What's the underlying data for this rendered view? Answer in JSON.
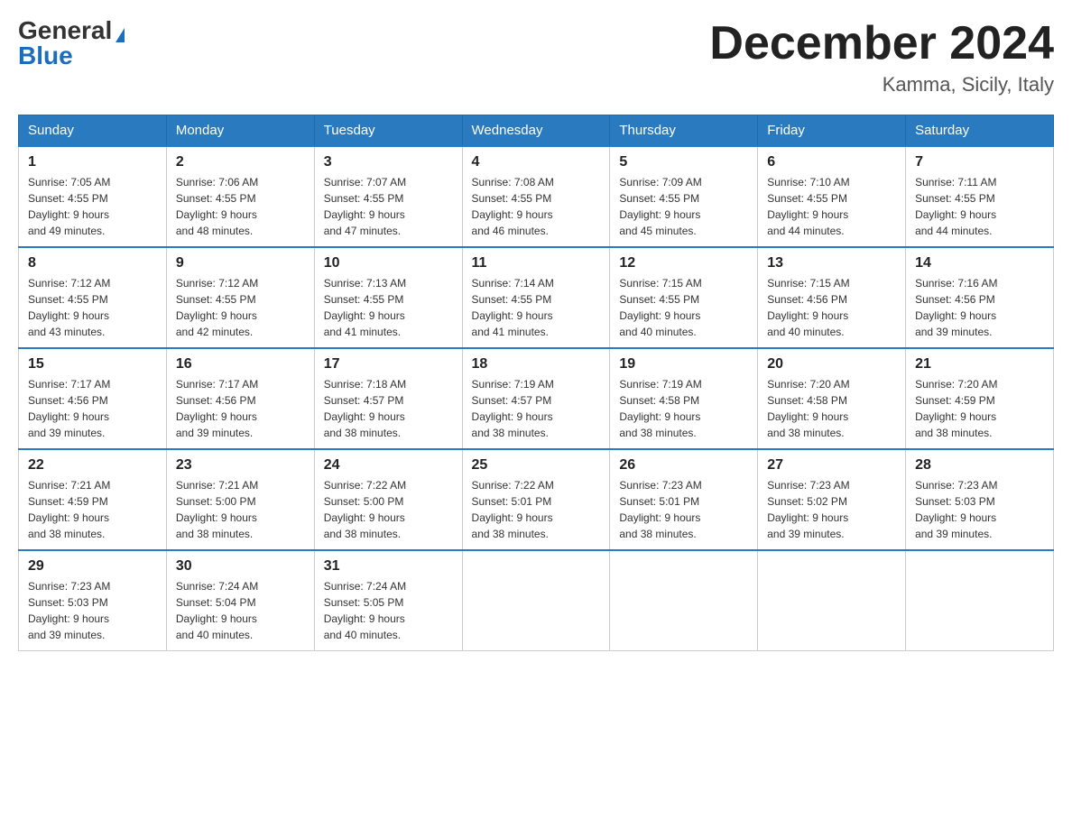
{
  "header": {
    "logo_general": "General",
    "logo_blue": "Blue",
    "month_title": "December 2024",
    "location": "Kamma, Sicily, Italy"
  },
  "days_of_week": [
    "Sunday",
    "Monday",
    "Tuesday",
    "Wednesday",
    "Thursday",
    "Friday",
    "Saturday"
  ],
  "weeks": [
    [
      {
        "day": "1",
        "sunrise": "7:05 AM",
        "sunset": "4:55 PM",
        "daylight": "9 hours and 49 minutes."
      },
      {
        "day": "2",
        "sunrise": "7:06 AM",
        "sunset": "4:55 PM",
        "daylight": "9 hours and 48 minutes."
      },
      {
        "day": "3",
        "sunrise": "7:07 AM",
        "sunset": "4:55 PM",
        "daylight": "9 hours and 47 minutes."
      },
      {
        "day": "4",
        "sunrise": "7:08 AM",
        "sunset": "4:55 PM",
        "daylight": "9 hours and 46 minutes."
      },
      {
        "day": "5",
        "sunrise": "7:09 AM",
        "sunset": "4:55 PM",
        "daylight": "9 hours and 45 minutes."
      },
      {
        "day": "6",
        "sunrise": "7:10 AM",
        "sunset": "4:55 PM",
        "daylight": "9 hours and 44 minutes."
      },
      {
        "day": "7",
        "sunrise": "7:11 AM",
        "sunset": "4:55 PM",
        "daylight": "9 hours and 44 minutes."
      }
    ],
    [
      {
        "day": "8",
        "sunrise": "7:12 AM",
        "sunset": "4:55 PM",
        "daylight": "9 hours and 43 minutes."
      },
      {
        "day": "9",
        "sunrise": "7:12 AM",
        "sunset": "4:55 PM",
        "daylight": "9 hours and 42 minutes."
      },
      {
        "day": "10",
        "sunrise": "7:13 AM",
        "sunset": "4:55 PM",
        "daylight": "9 hours and 41 minutes."
      },
      {
        "day": "11",
        "sunrise": "7:14 AM",
        "sunset": "4:55 PM",
        "daylight": "9 hours and 41 minutes."
      },
      {
        "day": "12",
        "sunrise": "7:15 AM",
        "sunset": "4:55 PM",
        "daylight": "9 hours and 40 minutes."
      },
      {
        "day": "13",
        "sunrise": "7:15 AM",
        "sunset": "4:56 PM",
        "daylight": "9 hours and 40 minutes."
      },
      {
        "day": "14",
        "sunrise": "7:16 AM",
        "sunset": "4:56 PM",
        "daylight": "9 hours and 39 minutes."
      }
    ],
    [
      {
        "day": "15",
        "sunrise": "7:17 AM",
        "sunset": "4:56 PM",
        "daylight": "9 hours and 39 minutes."
      },
      {
        "day": "16",
        "sunrise": "7:17 AM",
        "sunset": "4:56 PM",
        "daylight": "9 hours and 39 minutes."
      },
      {
        "day": "17",
        "sunrise": "7:18 AM",
        "sunset": "4:57 PM",
        "daylight": "9 hours and 38 minutes."
      },
      {
        "day": "18",
        "sunrise": "7:19 AM",
        "sunset": "4:57 PM",
        "daylight": "9 hours and 38 minutes."
      },
      {
        "day": "19",
        "sunrise": "7:19 AM",
        "sunset": "4:58 PM",
        "daylight": "9 hours and 38 minutes."
      },
      {
        "day": "20",
        "sunrise": "7:20 AM",
        "sunset": "4:58 PM",
        "daylight": "9 hours and 38 minutes."
      },
      {
        "day": "21",
        "sunrise": "7:20 AM",
        "sunset": "4:59 PM",
        "daylight": "9 hours and 38 minutes."
      }
    ],
    [
      {
        "day": "22",
        "sunrise": "7:21 AM",
        "sunset": "4:59 PM",
        "daylight": "9 hours and 38 minutes."
      },
      {
        "day": "23",
        "sunrise": "7:21 AM",
        "sunset": "5:00 PM",
        "daylight": "9 hours and 38 minutes."
      },
      {
        "day": "24",
        "sunrise": "7:22 AM",
        "sunset": "5:00 PM",
        "daylight": "9 hours and 38 minutes."
      },
      {
        "day": "25",
        "sunrise": "7:22 AM",
        "sunset": "5:01 PM",
        "daylight": "9 hours and 38 minutes."
      },
      {
        "day": "26",
        "sunrise": "7:23 AM",
        "sunset": "5:01 PM",
        "daylight": "9 hours and 38 minutes."
      },
      {
        "day": "27",
        "sunrise": "7:23 AM",
        "sunset": "5:02 PM",
        "daylight": "9 hours and 39 minutes."
      },
      {
        "day": "28",
        "sunrise": "7:23 AM",
        "sunset": "5:03 PM",
        "daylight": "9 hours and 39 minutes."
      }
    ],
    [
      {
        "day": "29",
        "sunrise": "7:23 AM",
        "sunset": "5:03 PM",
        "daylight": "9 hours and 39 minutes."
      },
      {
        "day": "30",
        "sunrise": "7:24 AM",
        "sunset": "5:04 PM",
        "daylight": "9 hours and 40 minutes."
      },
      {
        "day": "31",
        "sunrise": "7:24 AM",
        "sunset": "5:05 PM",
        "daylight": "9 hours and 40 minutes."
      },
      null,
      null,
      null,
      null
    ]
  ],
  "labels": {
    "sunrise": "Sunrise:",
    "sunset": "Sunset:",
    "daylight": "Daylight:"
  }
}
